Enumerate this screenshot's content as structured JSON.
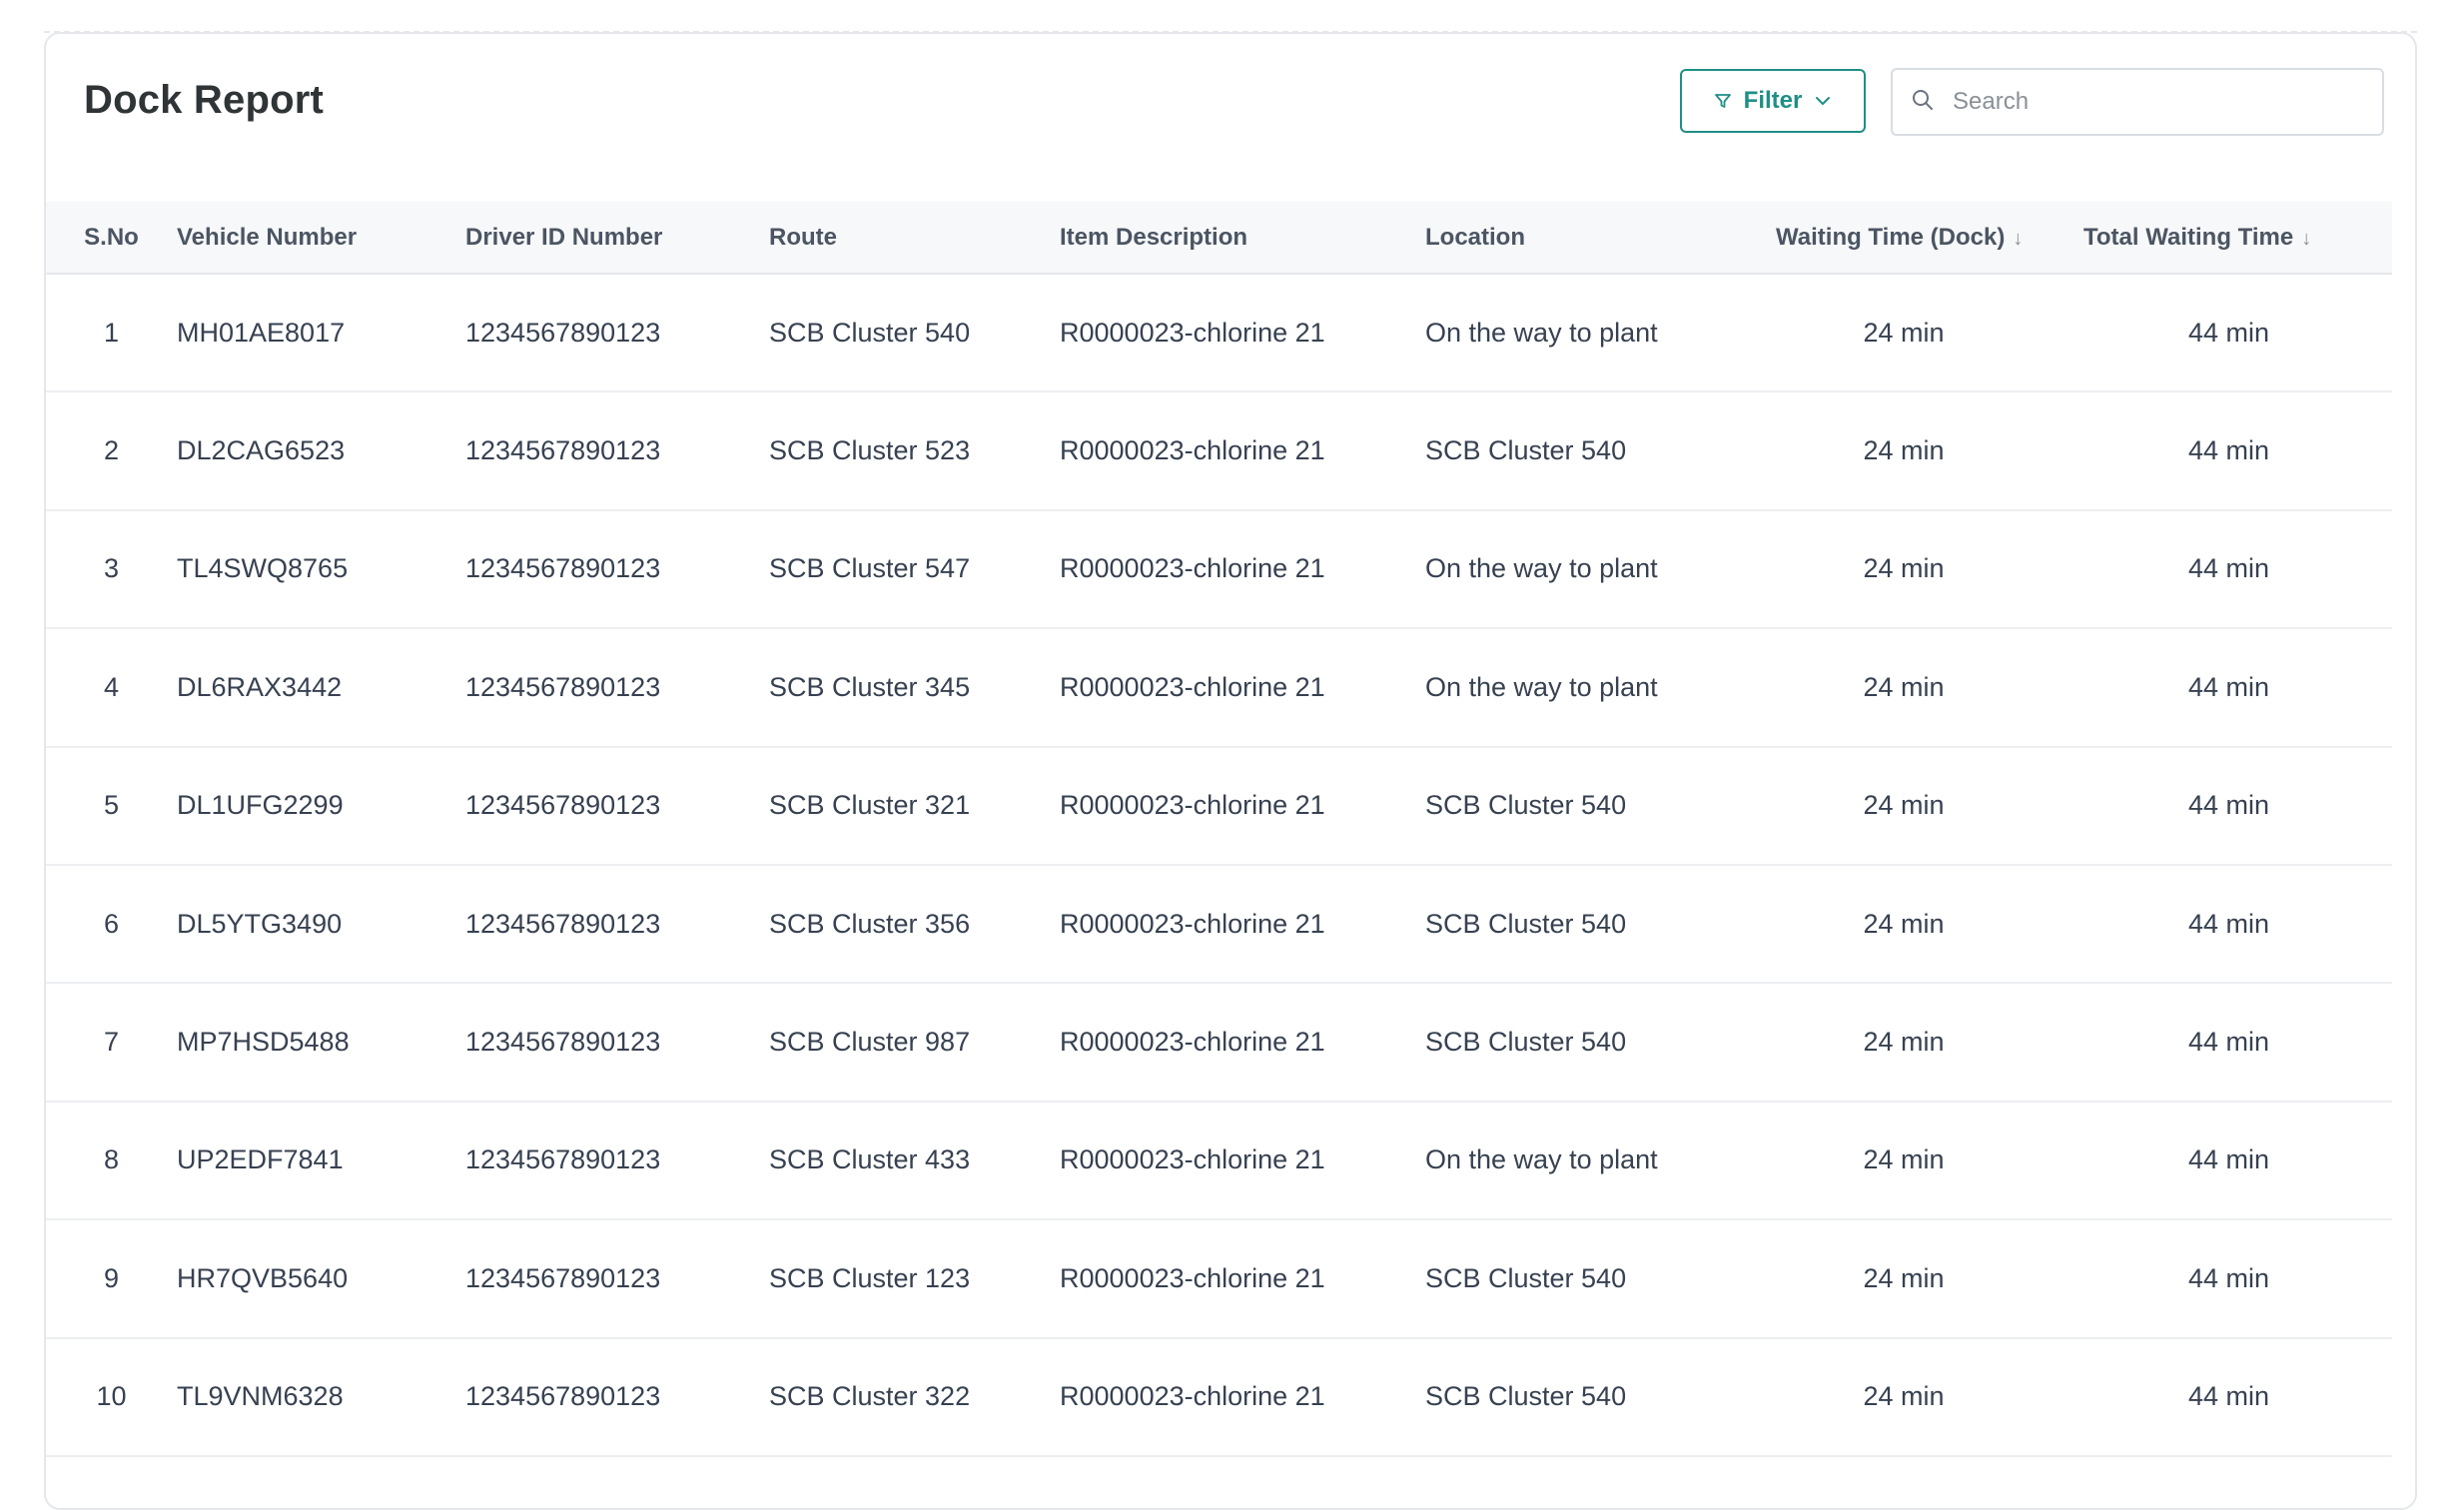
{
  "page": {
    "title": "Dock Report"
  },
  "toolbar": {
    "filter_label": "Filter",
    "search_placeholder": "Search"
  },
  "icons": {
    "filter": "funnel-icon",
    "chevron": "chevron-down-icon",
    "search": "search-icon",
    "sort": "arrow-down-icon"
  },
  "colors": {
    "accent": "#1f8f86",
    "header_bg": "#f7f8f9",
    "border": "#e5e7eb",
    "text": "#374151"
  },
  "table": {
    "columns": [
      {
        "label": "S.No",
        "sortable": false
      },
      {
        "label": "Vehicle Number",
        "sortable": false
      },
      {
        "label": "Driver ID Number",
        "sortable": false
      },
      {
        "label": "Route",
        "sortable": false
      },
      {
        "label": "Item Description",
        "sortable": false
      },
      {
        "label": "Location",
        "sortable": false
      },
      {
        "label": "Waiting Time (Dock)",
        "sortable": true
      },
      {
        "label": "Total Waiting Time",
        "sortable": true
      }
    ],
    "rows": [
      [
        "1",
        "MH01AE8017",
        "1234567890123",
        "SCB Cluster 540",
        "R0000023-chlorine 21",
        "On the way to plant",
        "24 min",
        "44 min"
      ],
      [
        "2",
        "DL2CAG6523",
        "1234567890123",
        "SCB Cluster 523",
        "R0000023-chlorine 21",
        "SCB Cluster 540",
        "24 min",
        "44 min"
      ],
      [
        "3",
        "TL4SWQ8765",
        "1234567890123",
        "SCB Cluster 547",
        "R0000023-chlorine 21",
        "On the way to plant",
        "24 min",
        "44 min"
      ],
      [
        "4",
        "DL6RAX3442",
        "1234567890123",
        "SCB Cluster 345",
        "R0000023-chlorine 21",
        "On the way to plant",
        "24 min",
        "44 min"
      ],
      [
        "5",
        "DL1UFG2299",
        "1234567890123",
        "SCB Cluster 321",
        "R0000023-chlorine 21",
        "SCB Cluster 540",
        "24 min",
        "44 min"
      ],
      [
        "6",
        "DL5YTG3490",
        "1234567890123",
        "SCB Cluster 356",
        "R0000023-chlorine 21",
        "SCB Cluster 540",
        "24 min",
        "44 min"
      ],
      [
        "7",
        "MP7HSD5488",
        "1234567890123",
        "SCB Cluster 987",
        "R0000023-chlorine 21",
        "SCB Cluster 540",
        "24 min",
        "44 min"
      ],
      [
        "8",
        "UP2EDF7841",
        "1234567890123",
        "SCB Cluster 433",
        "R0000023-chlorine 21",
        "On the way to plant",
        "24 min",
        "44 min"
      ],
      [
        "9",
        "HR7QVB5640",
        "1234567890123",
        "SCB Cluster 123",
        "R0000023-chlorine 21",
        "SCB Cluster 540",
        "24 min",
        "44 min"
      ],
      [
        "10",
        "TL9VNM6328",
        "1234567890123",
        "SCB Cluster 322",
        "R0000023-chlorine 21",
        "SCB Cluster 540",
        "24 min",
        "44 min"
      ]
    ]
  }
}
